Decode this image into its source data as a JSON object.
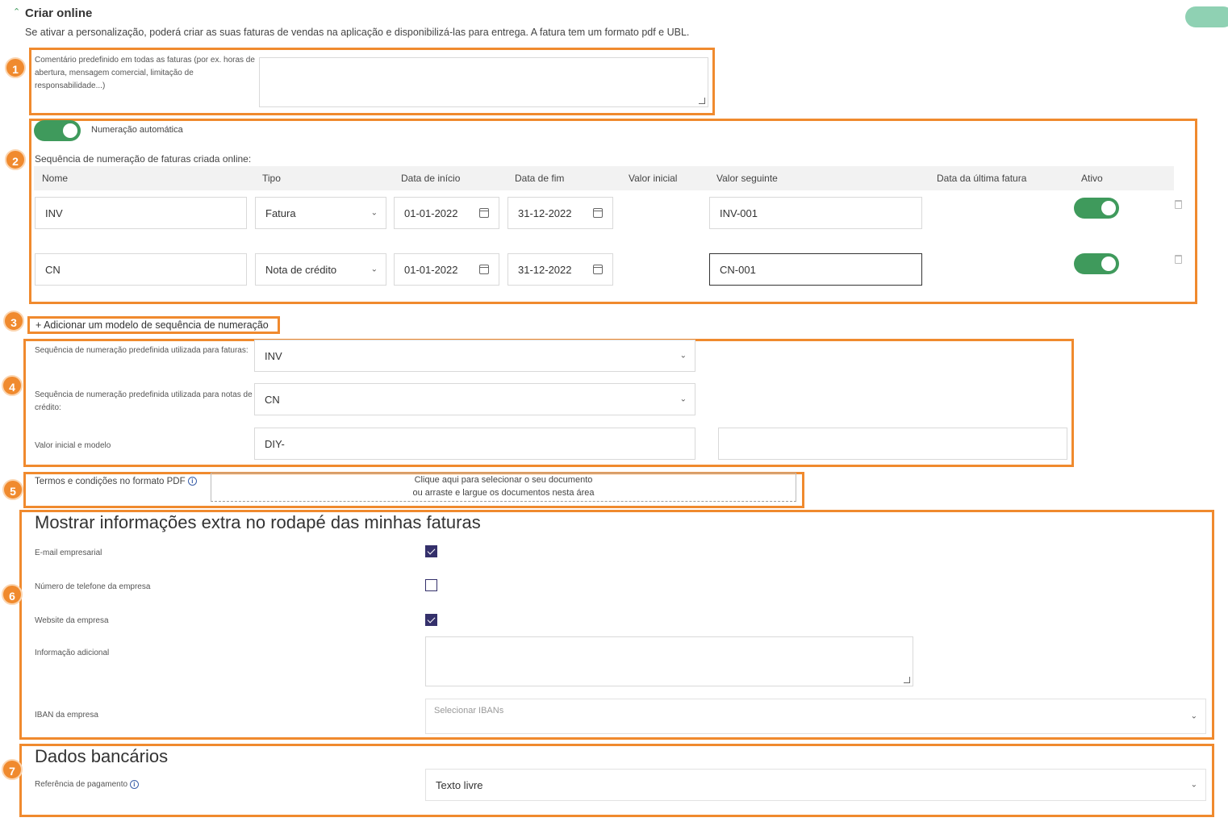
{
  "header": {
    "title": "Criar online",
    "description": "Se ativar a personalização, poderá criar as suas faturas de vendas na aplicação e disponibilizá-las para entrega. A fatura tem um formato pdf e UBL."
  },
  "badges": [
    "1",
    "2",
    "3",
    "4",
    "5",
    "6",
    "7"
  ],
  "section1": {
    "comment_label": "Comentário predefinido em todas as faturas (por ex. horas de abertura, mensagem comercial, limitação de responsabilidade...)",
    "comment_value": ""
  },
  "section2": {
    "auto_numbering_label": "Numeração automática",
    "auto_numbering_on": true,
    "sequence_label": "Sequência de numeração de faturas criada online:",
    "columns": [
      "Nome",
      "Tipo",
      "Data de início",
      "Data de fim",
      "Valor inicial",
      "Valor seguinte",
      "Data da última fatura",
      "Ativo"
    ],
    "rows": [
      {
        "name": "INV",
        "type": "Fatura",
        "start": "01-01-2022",
        "end": "31-12-2022",
        "next": "INV-001",
        "active": true
      },
      {
        "name": "CN",
        "type": "Nota de crédito",
        "start": "01-01-2022",
        "end": "31-12-2022",
        "next": "CN-001",
        "active": true
      }
    ]
  },
  "section3": {
    "add_link": "+ Adicionar um modelo de sequência de numeração"
  },
  "section4": {
    "invoice_seq_label": "Sequência de numeração predefinida utilizada para faturas:",
    "invoice_seq_value": "INV",
    "credit_seq_label": "Sequência de numeração predefinida utilizada para notas de crédito:",
    "credit_seq_value": "CN",
    "initial_model_label": "Valor inicial e modelo",
    "initial_model_value": "DIY-",
    "extra_value": ""
  },
  "section5": {
    "terms_label": "Termos e condições no formato PDF",
    "dropzone_line1": "Clique aqui para selecionar o seu documento",
    "dropzone_line2": "ou arraste e largue os documentos nesta área"
  },
  "section6": {
    "title": "Mostrar informações extra no rodapé das minhas faturas",
    "email_label": "E-mail empresarial",
    "email_checked": true,
    "phone_label": "Número de telefone da empresa",
    "phone_checked": false,
    "website_label": "Website da empresa",
    "website_checked": true,
    "additional_label": "Informação adicional",
    "iban_label": "IBAN da empresa",
    "iban_placeholder": "Selecionar IBANs"
  },
  "section7": {
    "title": "Dados bancários",
    "payment_ref_label": "Referência de pagamento",
    "payment_ref_value": "Texto livre"
  },
  "colors": {
    "highlight": "#f08a2e",
    "toggle_on": "#3f9a5c",
    "checkbox": "#34306b"
  }
}
